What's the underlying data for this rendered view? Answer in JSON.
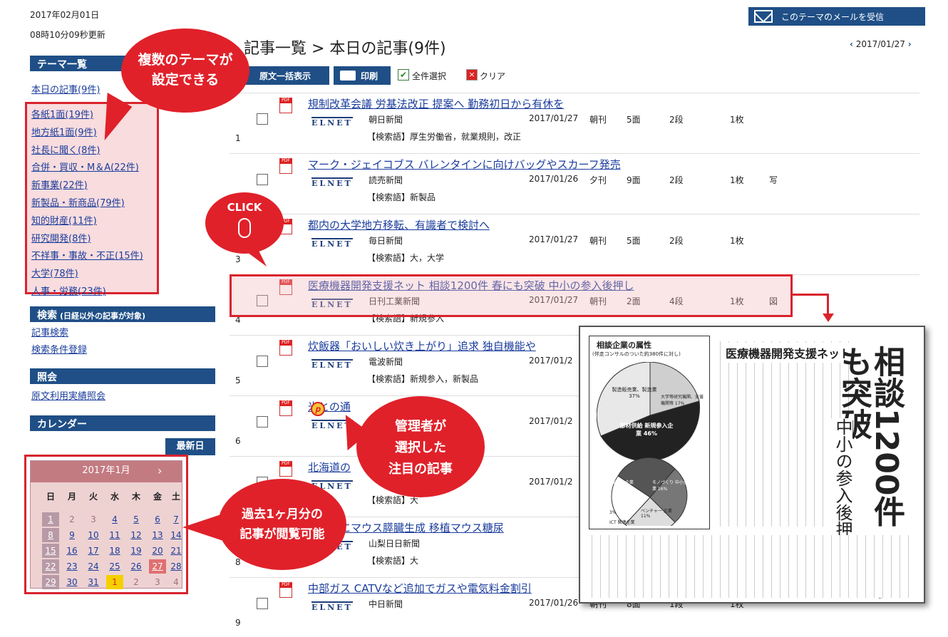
{
  "header": {
    "date": "2017年02月01日",
    "updated": "08時10分09秒更新",
    "mail_button": "このテーマのメールを受信"
  },
  "sidebar": {
    "theme_heading": "テーマ一覧",
    "today": "本日の記事(9件)",
    "themes": [
      "各紙1面(19件)",
      "地方紙1面(9件)",
      "社長に聞く(8件)",
      "合併・買収・M＆A(22件)",
      "新事業(22件)",
      "新製品・新商品(79件)",
      "知的財産(11件)",
      "研究開発(8件)",
      "不祥事・事故・不正(15件)",
      "大学(78件)",
      "人事・労務(23件)"
    ],
    "search_heading": "検索",
    "search_note": "(日経以外の記事が対象)",
    "search_links": [
      "記事検索",
      "検索条件登録"
    ],
    "ref_heading": "照会",
    "ref_link": "原文利用実績照会",
    "cal_heading": "カレンダー",
    "latest_button": "最新日"
  },
  "calendar": {
    "month": "2017年1月",
    "next": "›",
    "weekdays": [
      "日",
      "月",
      "火",
      "水",
      "木",
      "金",
      "土"
    ],
    "weeks": [
      [
        "1",
        "2",
        "3",
        "4",
        "5",
        "6",
        "7"
      ],
      [
        "8",
        "9",
        "10",
        "11",
        "12",
        "13",
        "14"
      ],
      [
        "15",
        "16",
        "17",
        "18",
        "19",
        "20",
        "21"
      ],
      [
        "22",
        "23",
        "24",
        "25",
        "26",
        "27",
        "28"
      ],
      [
        "29",
        "30",
        "31",
        "1",
        "2",
        "3",
        "4"
      ]
    ]
  },
  "main": {
    "title": "記事一覧 > 本日の記事(9件)",
    "nav_date": "2017/01/27",
    "btn_fulltext": "原文一括表示",
    "btn_print": "印刷",
    "select_all": "全件選択",
    "clear": "クリア"
  },
  "articles": [
    {
      "num": "1",
      "title": "規制改革会議 労基法改正 提案へ 勤務初日から有休を",
      "paper": "朝日新聞",
      "date": "2017/01/27",
      "edition": "朝刊",
      "page": "5面",
      "dan": "2段",
      "mai": "1枚",
      "extra": "",
      "keywords": "【検索語】厚生労働省，就業規則，改正"
    },
    {
      "num": "2",
      "title": "マーク・ジェイコブス バレンタインに向けバッグやスカーフ発売",
      "paper": "読売新聞",
      "date": "2017/01/26",
      "edition": "夕刊",
      "page": "9面",
      "dan": "2段",
      "mai": "1枚",
      "extra": "写",
      "keywords": "【検索語】新製品"
    },
    {
      "num": "3",
      "title": "都内の大学地方移転、有識者で検討へ",
      "paper": "毎日新聞",
      "date": "2017/01/27",
      "edition": "朝刊",
      "page": "5面",
      "dan": "2段",
      "mai": "1枚",
      "extra": "",
      "keywords": "【検索語】大，大学"
    },
    {
      "num": "4",
      "title": "医療機器開発支援ネット 相談1200件 春にも突破 中小の参入後押し",
      "paper": "日刊工業新聞",
      "date": "2017/01/27",
      "edition": "朝刊",
      "page": "2面",
      "dan": "4段",
      "mai": "1枚",
      "extra": "図",
      "keywords": "【検索語】新規参入"
    },
    {
      "num": "5",
      "title": "炊飯器「おいしい炊き上がり」追求 独自機能や",
      "paper": "電波新聞",
      "date": "2017/01/2",
      "edition": "",
      "page": "",
      "dan": "",
      "mai": "",
      "extra": "",
      "keywords": "【検索語】新規参入，新製品"
    },
    {
      "num": "6",
      "title": "米との通",
      "paper": "",
      "date": "2017/01/2",
      "edition": "",
      "page": "",
      "dan": "",
      "mai": "",
      "extra": "",
      "keywords": ""
    },
    {
      "num": "7",
      "title": "北海道の",
      "paper": "",
      "date": "2017/01/2",
      "edition": "",
      "page": "",
      "dan": "",
      "mai": "",
      "extra": "",
      "keywords": "【検索語】大"
    },
    {
      "num": "8",
      "title": "ット内にマウス膵臓生成 移植マウス糖尿",
      "paper": "山梨日日新聞",
      "date": "",
      "edition": "",
      "page": "",
      "dan": "",
      "mai": "",
      "extra": "",
      "keywords": "【検索語】大"
    },
    {
      "num": "9",
      "title": "中部ガス CATVなど追加でガスや電気料金割引",
      "paper": "中日新聞",
      "date": "2017/01/26",
      "edition": "朝刊",
      "page": "8面",
      "dan": "1段",
      "mai": "1枚",
      "extra": "",
      "keywords": ""
    }
  ],
  "logo_text": "ELNET",
  "callouts": {
    "themes": [
      "複数のテーマが",
      "設定できる"
    ],
    "click": "CLICK",
    "admin": [
      "管理者が",
      "選択した",
      "注目の記事"
    ],
    "past": [
      "過去1ヶ月分の",
      "記事が閲覧可能"
    ]
  },
  "clipping": {
    "headline_big": "相談1200件 春にも突破",
    "headline_sub": "中小の参入後押し",
    "banner": "医療機器開発支援ネット",
    "chart_title": "相談企業の属性",
    "chart_note": "(伴走コンサルのついた約380件に対し)",
    "pie1": [
      "製造販売業、製造業 37%",
      "大学等研究機関、支援機関等 17%",
      "部材供給 新規参入企業 46%"
    ],
    "pie2": [
      "大手製造業 企業 16%",
      "モノづくり 中小企業 16%",
      "ベンチャー 企業 11%",
      "3%",
      "ICT 関連企業"
    ]
  },
  "colors": {
    "navy": "#1f4f86",
    "red": "#e0212a",
    "link": "#1b3d9c"
  }
}
